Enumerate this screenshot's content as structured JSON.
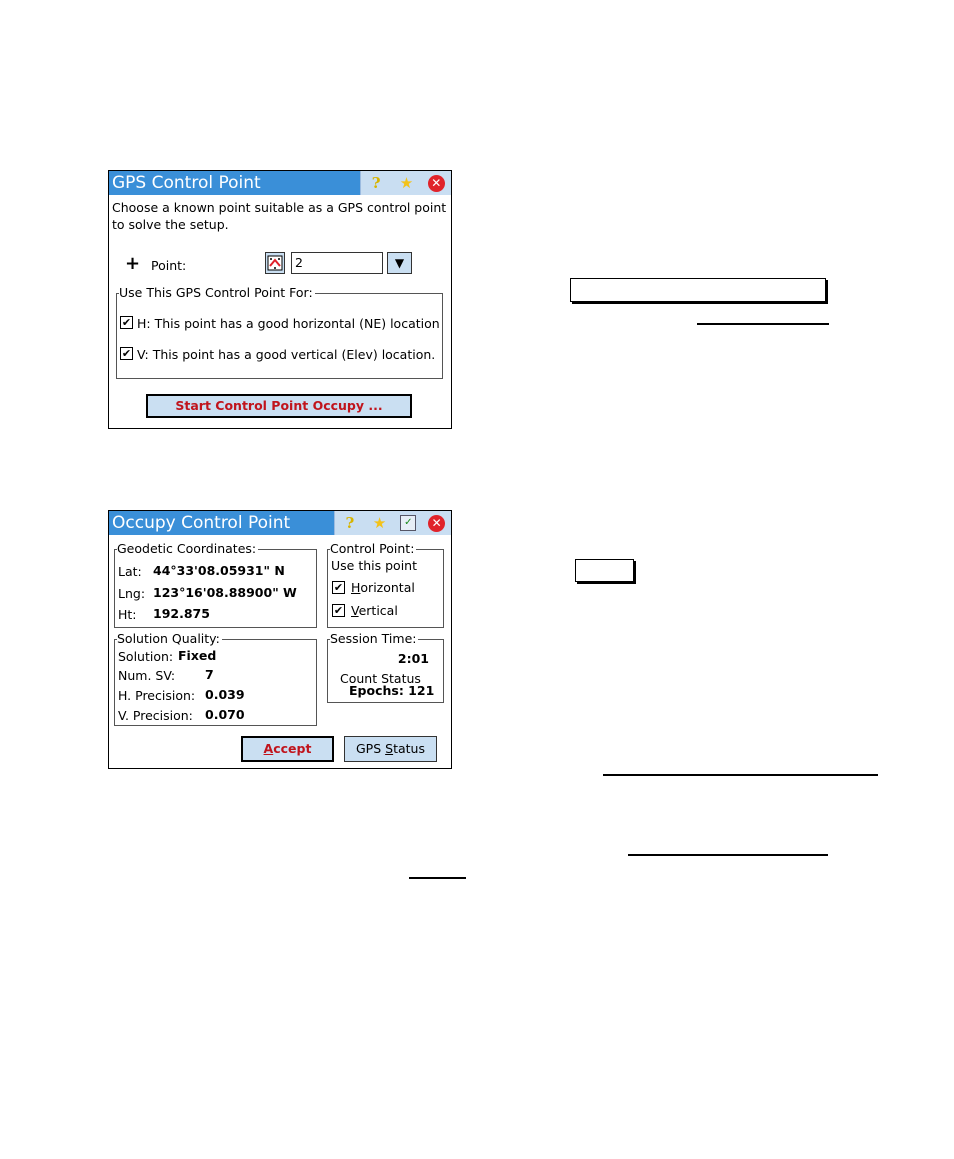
{
  "window1": {
    "title": "GPS Control Point",
    "icons": [
      "help-icon",
      "favorites-star-icon",
      "close-icon"
    ],
    "instructions_line1": "Choose a known point suitable as a GPS control point",
    "instructions_line2": "to solve the setup.",
    "add_symbol": "+",
    "point_label": "Point:",
    "point_value": "2",
    "group_label": "Use This GPS Control Point For:",
    "options": [
      {
        "checked": true,
        "label": "H:  This point has a good horizontal (NE) location"
      },
      {
        "checked": true,
        "label": "V:  This point has a good vertical (Elev) location."
      }
    ],
    "start_button": "Start Control Point Occupy ..."
  },
  "window2": {
    "title": "Occupy Control Point",
    "icons": [
      "help-icon",
      "favorites-star-icon",
      "checklist-icon",
      "close-icon"
    ],
    "geodetic": {
      "label": "Geodetic Coordinates:",
      "lat_label": "Lat:",
      "lat_value": "44°33'08.05931\" N",
      "lng_label": "Lng:",
      "lng_value": "123°16'08.88900\" W",
      "ht_label": "Ht:",
      "ht_value": "192.875"
    },
    "control_point": {
      "label": "Control Point:",
      "use_label": "Use this point",
      "horizontal_prefix": "H",
      "horizontal_rest": "orizontal",
      "horizontal_checked": true,
      "vertical_prefix": "V",
      "vertical_rest": "ertical",
      "vertical_checked": true
    },
    "solution": {
      "label": "Solution Quality:",
      "solution_label": "Solution:",
      "solution_value": "Fixed",
      "numsv_label": "Num. SV:",
      "numsv_value": "7",
      "hprec_label": "H. Precision:",
      "hprec_value": "0.039",
      "vprec_label": "V. Precision:",
      "vprec_value": "0.070"
    },
    "session": {
      "label": "Session Time:",
      "time": "2:01",
      "count_status": "Count Status",
      "epochs": "Epochs: 121"
    },
    "accept_prefix": "A",
    "accept_rest": "ccept",
    "gps_status_a": "GPS ",
    "gps_status_u": "S",
    "gps_status_b": "tatus"
  },
  "check_mark": "✔",
  "glyphs": {
    "help": "?",
    "star": "★",
    "close": "✕",
    "dropdown": "▼",
    "checklist": "✓"
  }
}
